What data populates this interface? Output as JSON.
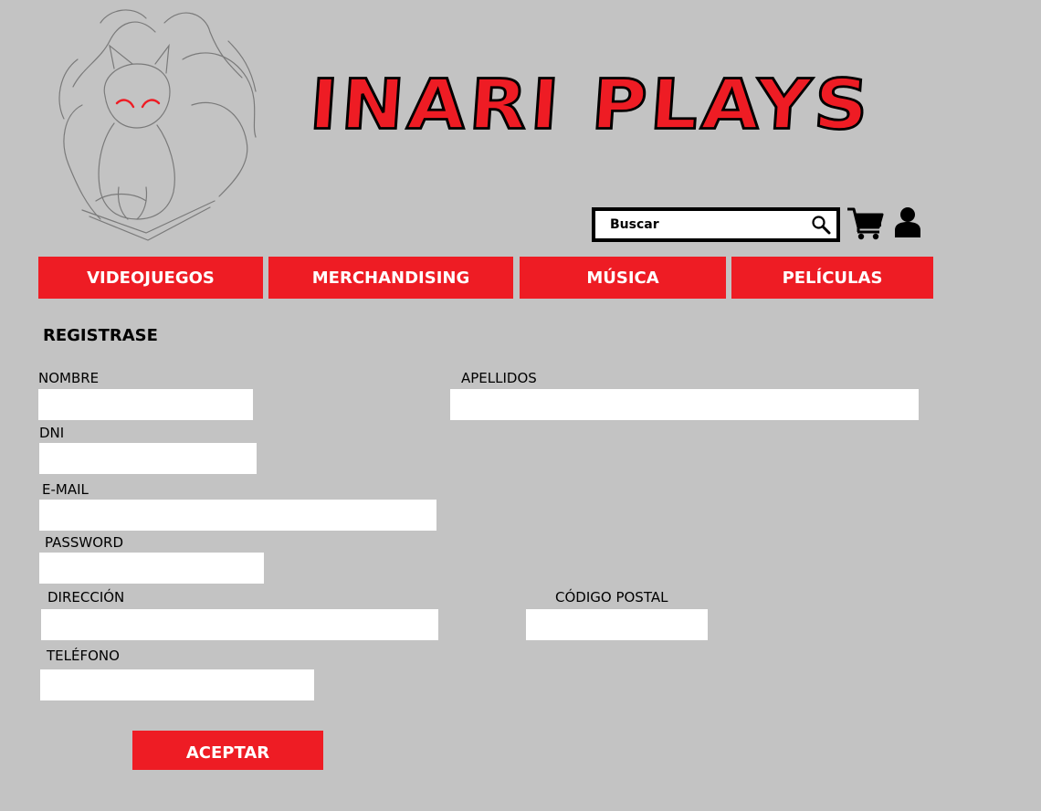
{
  "header": {
    "brand": "INARI PLAYS",
    "logo_icon": "fox-sketch-logo",
    "search": {
      "placeholder": "Buscar",
      "value": ""
    },
    "cart_icon": "shopping-cart-icon",
    "user_icon": "user-account-icon"
  },
  "nav": {
    "items": [
      {
        "label": "VIDEOJUEGOS"
      },
      {
        "label": "MERCHANDISING"
      },
      {
        "label": "MÚSICA"
      },
      {
        "label": "PELÍCULAS"
      }
    ]
  },
  "form": {
    "title": "REGISTRASE",
    "fields": {
      "nombre": {
        "label": "NOMBRE",
        "value": ""
      },
      "apellidos": {
        "label": "APELLIDOS",
        "value": ""
      },
      "dni": {
        "label": "DNI",
        "value": ""
      },
      "email": {
        "label": "E-MAIL",
        "value": ""
      },
      "password": {
        "label": "PASSWORD",
        "value": ""
      },
      "direccion": {
        "label": "DIRECCIÓN",
        "value": ""
      },
      "codigo_postal": {
        "label": "CÓDIGO POSTAL",
        "value": ""
      },
      "telefono": {
        "label": "TELÉFONO",
        "value": ""
      }
    },
    "submit_label": "ACEPTAR"
  },
  "colors": {
    "background": "#c3c3c3",
    "accent": "#ee1c24",
    "field": "#ffffff"
  }
}
